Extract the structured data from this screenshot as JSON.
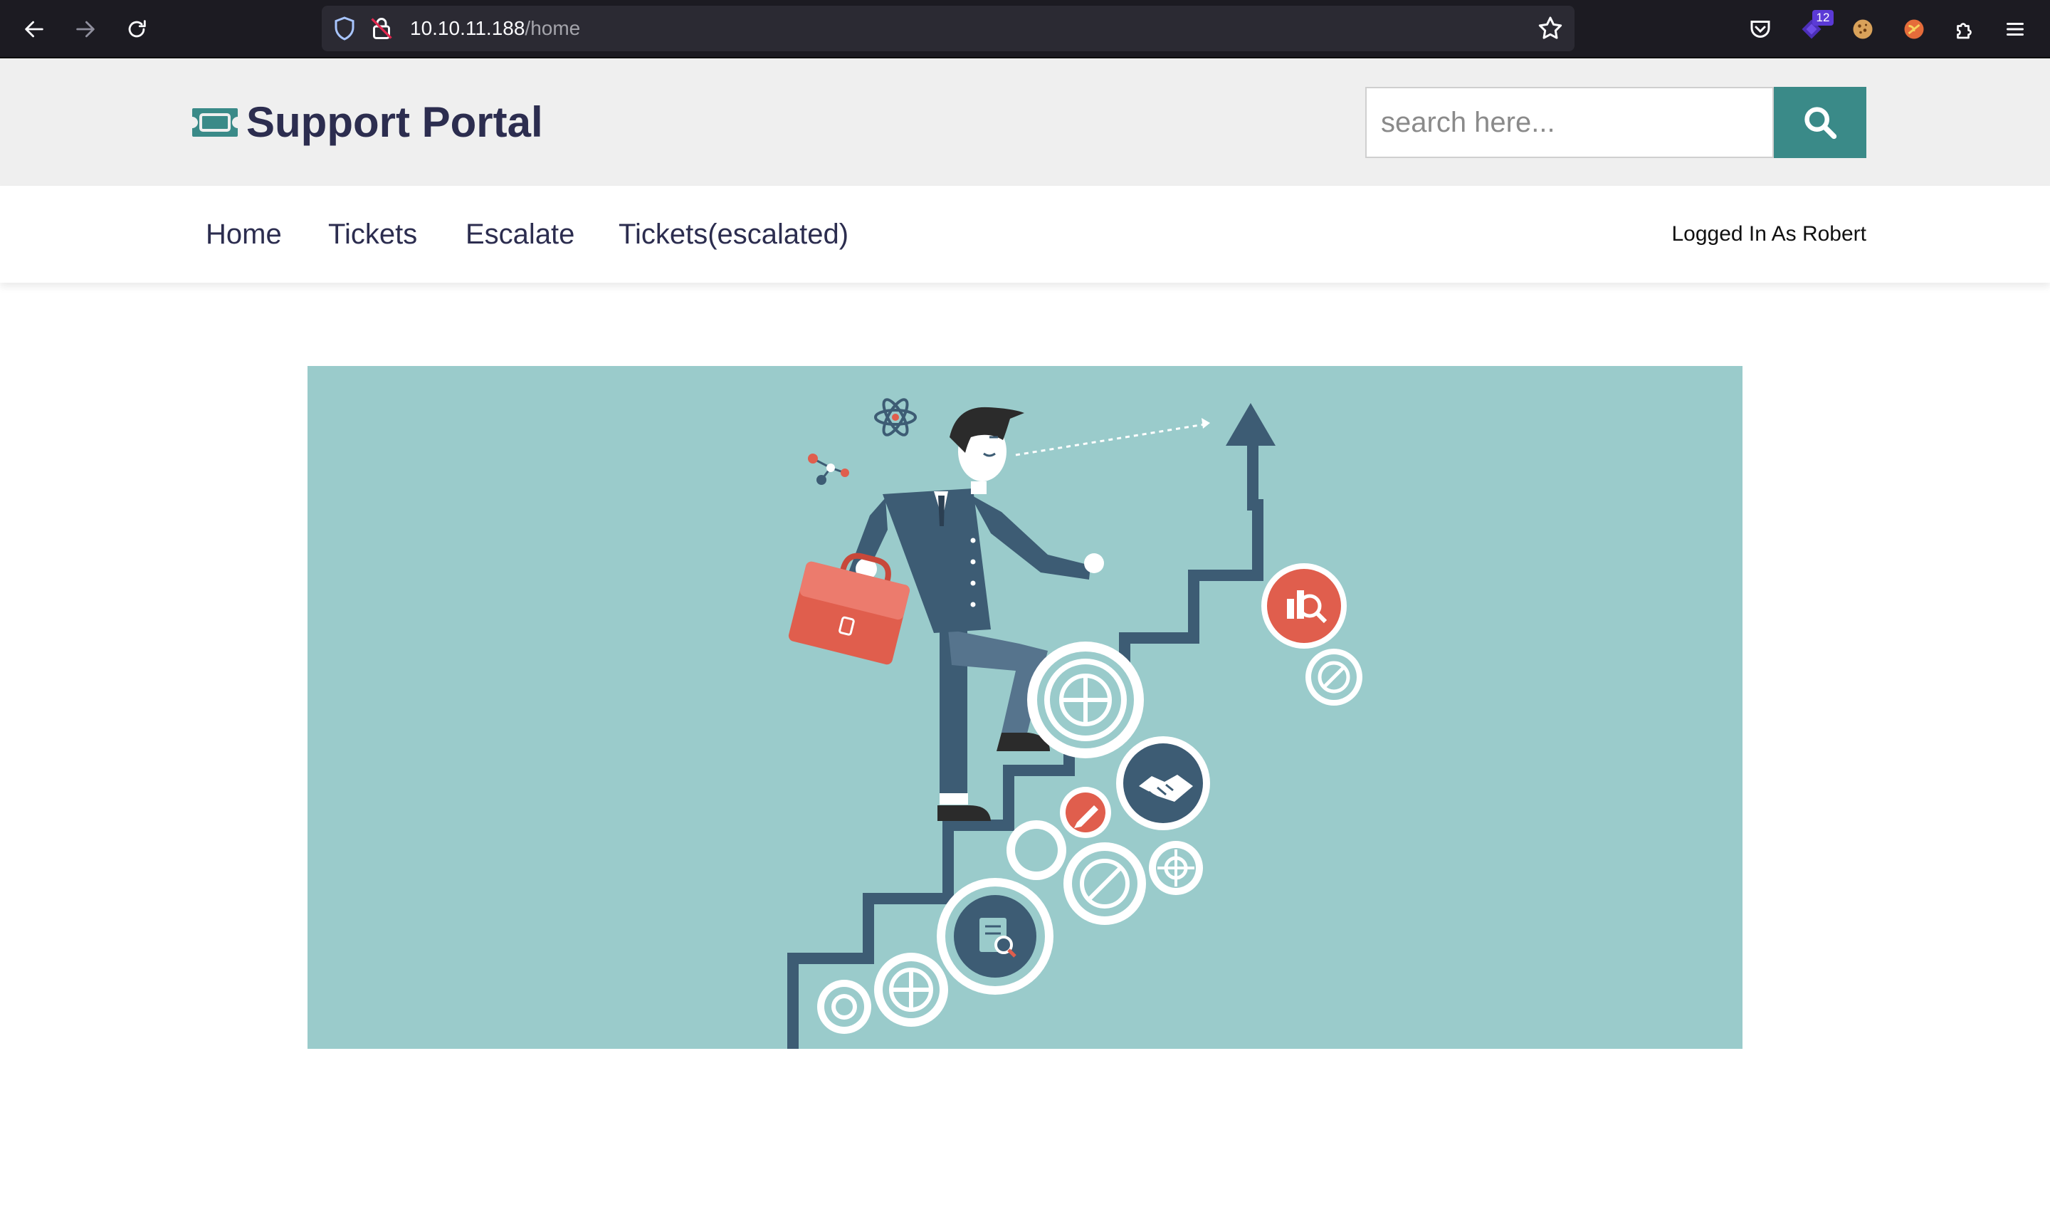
{
  "browser": {
    "url_host": "10.10.11.188",
    "url_path": "/home",
    "extension_badge": "12",
    "icons": [
      "back-icon",
      "forward-icon",
      "reload-icon",
      "shield-icon",
      "lock-icon",
      "bookmark-star-icon",
      "pocket-icon",
      "extension-icon",
      "cookie-icon",
      "extension-icon",
      "puzzle-icon",
      "menu-icon"
    ]
  },
  "header": {
    "logo_text": "Support Portal",
    "search_placeholder": "search here...",
    "accent_color": "#3a8a88",
    "brand_color": "#2c2d4f"
  },
  "nav": {
    "items": [
      {
        "label": "Home"
      },
      {
        "label": "Tickets"
      },
      {
        "label": "Escalate"
      },
      {
        "label": "Tickets(escalated)"
      }
    ],
    "user_status": "Logged In As Robert"
  },
  "hero": {
    "background_color": "#9acbcb",
    "illustration": "businessman-climbing-stairs-with-gears"
  }
}
